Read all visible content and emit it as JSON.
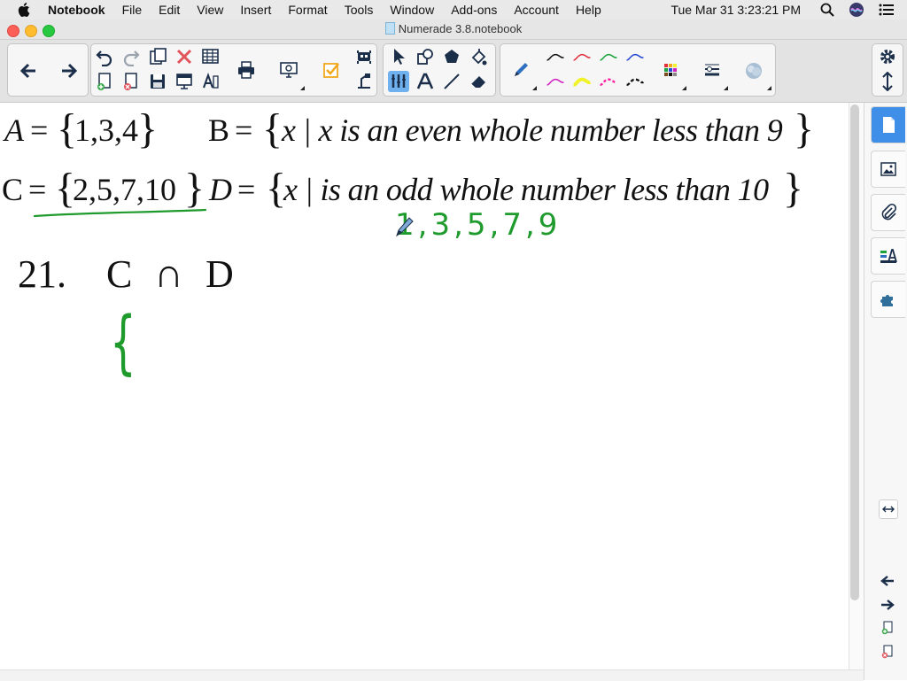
{
  "menubar": {
    "app_name": "Notebook",
    "items": [
      "File",
      "Edit",
      "View",
      "Insert",
      "Format",
      "Tools",
      "Window",
      "Add-ons",
      "Account",
      "Help"
    ],
    "clock": "Tue Mar 31  3:23:21 PM"
  },
  "window": {
    "title": "Numerade 3.8.notebook"
  },
  "page": {
    "line1_a_label": "A",
    "line1_a_set": "1,3,4",
    "line1_b_label": "B",
    "line1_b_desc": "x | x is an even whole number less than 9",
    "line2_c_label": "C",
    "line2_c_set": "2,5,7,10",
    "line2_d_label": "D",
    "line2_d_desc": "x | is an odd whole number less than 10",
    "equals": "=",
    "handwritten_odds": "1,3,5,7,9",
    "problem_number": "21.",
    "problem_expr_left": "C",
    "problem_operator": "∩",
    "problem_expr_right": "D",
    "handwritten_brace": "{"
  },
  "colors": {
    "ink_green": "#1f9b2d",
    "accent_blue": "#3f8fe8",
    "pen_black": "#111111",
    "pen_red": "#e0303c",
    "pen_green": "#1aa33a",
    "pen_blue": "#2547d6",
    "pen_magenta": "#d01fbf",
    "pen_yellow": "#f2f22a",
    "pen_pink": "#ff1fa0"
  }
}
